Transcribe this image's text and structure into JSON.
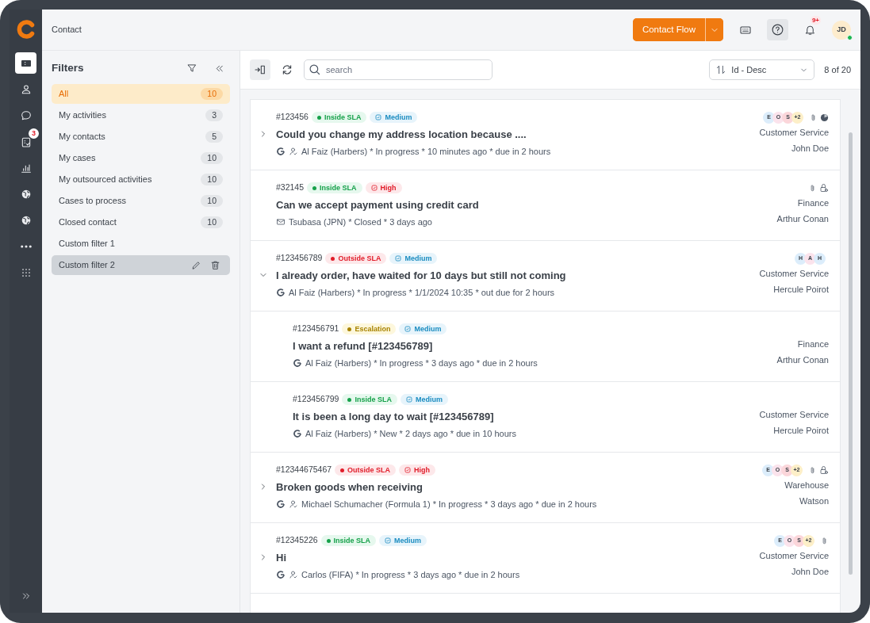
{
  "nav": {
    "items": [
      {
        "kind": "ticket",
        "selected": true
      },
      {
        "kind": "person",
        "selected": false
      },
      {
        "kind": "chat",
        "selected": false
      },
      {
        "kind": "tasks",
        "selected": false,
        "badge": "3"
      },
      {
        "kind": "chart",
        "selected": false
      },
      {
        "kind": "globe",
        "selected": false
      },
      {
        "kind": "globe",
        "selected": false
      },
      {
        "kind": "more",
        "selected": false
      },
      {
        "kind": "apps",
        "selected": false
      }
    ]
  },
  "header": {
    "title": "Contact",
    "primary_button": "Contact Flow",
    "help_selected": true,
    "notification_badge": "9+",
    "avatar": {
      "initials": "JD",
      "online": true
    }
  },
  "filters": {
    "title": "Filters",
    "items": [
      {
        "label": "All",
        "count": "10",
        "selected": true,
        "highlighted": false
      },
      {
        "label": "My activities",
        "count": "3",
        "selected": false,
        "highlighted": false
      },
      {
        "label": "My contacts",
        "count": "5",
        "selected": false,
        "highlighted": false
      },
      {
        "label": "My cases",
        "count": "10",
        "selected": false,
        "highlighted": false
      },
      {
        "label": "My outsourced activities",
        "count": "10",
        "selected": false,
        "highlighted": false
      },
      {
        "label": "Cases to process",
        "count": "10",
        "selected": false,
        "highlighted": false
      },
      {
        "label": "Closed contact",
        "count": "10",
        "selected": false,
        "highlighted": false
      },
      {
        "label": "Custom filter 1",
        "selected": false,
        "highlighted": false
      },
      {
        "label": "Custom filter 2",
        "selected": false,
        "highlighted": true
      }
    ]
  },
  "toolbar": {
    "search": {
      "placeholder": "search"
    },
    "sort": "Id - Desc",
    "count": "8 of 20"
  },
  "cases": [
    {
      "id": "#123456",
      "sla": {
        "label": "Inside SLA",
        "kind": "inside"
      },
      "priority": {
        "label": "Medium",
        "kind": "medium"
      },
      "title": "Could you change my address location because ....",
      "channel": {
        "kind": "google"
      },
      "contact_icon": true,
      "meta": "Al Faiz (Harbers) * In progress * 10 minutes ago * due in 2 hours",
      "expanded": false,
      "avatars": [
        {
          "initial": "E",
          "color": "#dcedfb"
        },
        {
          "initial": "O",
          "color": "#fbe3ec"
        },
        {
          "initial": "S",
          "color": "#fbd6da"
        }
      ],
      "more": "+2",
      "attachment": true,
      "lock": false,
      "progress": true,
      "team": "Customer Service",
      "assignee": "John Doe"
    },
    {
      "id": "#32145",
      "sla": {
        "label": "Inside SLA",
        "kind": "inside"
      },
      "priority": {
        "label": "High",
        "kind": "high"
      },
      "title": "Can we accept payment using credit card",
      "channel": {
        "kind": "email"
      },
      "contact_icon": false,
      "meta": "Tsubasa (JPN) * Closed * 3 days ago",
      "attachment": true,
      "lock": true,
      "progress": false,
      "team": "Finance",
      "assignee": "Arthur Conan"
    },
    {
      "id": "#123456789",
      "sla": {
        "label": "Outside SLA",
        "kind": "outside"
      },
      "priority": {
        "label": "Medium",
        "kind": "medium"
      },
      "title": "I already order, have waited for 10 days but still not coming",
      "channel": {
        "kind": "google"
      },
      "contact_icon": false,
      "meta": "Al Faiz (Harbers) * In progress * 1/1/2024 10:35 * out due for 2 hours",
      "expanded": true,
      "avatars": [
        {
          "initial": "H",
          "color": "#dcedfb"
        },
        {
          "initial": "A",
          "color": "#fbe3ec"
        },
        {
          "initial": "H",
          "color": "#dcedfb"
        }
      ],
      "attachment": false,
      "lock": false,
      "progress": false,
      "team": "Customer Service",
      "assignee": "Hercule Poirot",
      "children": [
        {
          "id": "#123456791",
          "sla": {
            "label": "Escalation",
            "kind": "escalation"
          },
          "priority": {
            "label": "Medium",
            "kind": "medium"
          },
          "title": "I want a refund [#123456789]",
          "channel": {
            "kind": "google"
          },
          "contact_icon": false,
          "meta": "Al Faiz (Harbers) * In progress * 3 days ago * due in 2 hours",
          "attachment": false,
          "lock": false,
          "progress": false,
          "team": "Finance",
          "assignee": "Arthur Conan"
        },
        {
          "id": "#123456799",
          "sla": {
            "label": "Inside SLA",
            "kind": "inside"
          },
          "priority": {
            "label": "Medium",
            "kind": "medium"
          },
          "title": "It is been a long day to wait [#123456789]",
          "channel": {
            "kind": "google"
          },
          "contact_icon": false,
          "meta": "Al Faiz (Harbers) * New * 2 days ago * due in 10 hours",
          "attachment": false,
          "lock": false,
          "progress": false,
          "team": "Customer Service",
          "assignee": "Hercule Poirot"
        }
      ]
    },
    {
      "id": "#12344675467",
      "sla": {
        "label": "Outside SLA",
        "kind": "outside"
      },
      "priority": {
        "label": "High",
        "kind": "high"
      },
      "title": "Broken goods when receiving",
      "channel": {
        "kind": "google"
      },
      "contact_icon": true,
      "meta": "Michael Schumacher (Formula 1) * In progress * 3 days ago * due in 2 hours",
      "expanded": false,
      "avatars": [
        {
          "initial": "E",
          "color": "#dcedfb"
        },
        {
          "initial": "O",
          "color": "#fbe3ec"
        },
        {
          "initial": "S",
          "color": "#fbd6da"
        }
      ],
      "more": "+2",
      "attachment": true,
      "lock": true,
      "progress": false,
      "team": "Warehouse",
      "assignee": "Watson"
    },
    {
      "id": "#12345226",
      "sla": {
        "label": "Inside SLA",
        "kind": "inside"
      },
      "priority": {
        "label": "Medium",
        "kind": "medium"
      },
      "title": "Hi",
      "channel": {
        "kind": "google"
      },
      "contact_icon": true,
      "meta": "Carlos (FIFA) * In progress * 3 days ago * due in 2 hours",
      "expanded": false,
      "avatars": [
        {
          "initial": "E",
          "color": "#dcedfb"
        },
        {
          "initial": "O",
          "color": "#fbe3ec"
        },
        {
          "initial": "S",
          "color": "#fbd6da"
        }
      ],
      "more": "+2",
      "attachment": true,
      "lock": false,
      "progress": false,
      "team": "Customer Service",
      "assignee": "John Doe"
    }
  ]
}
